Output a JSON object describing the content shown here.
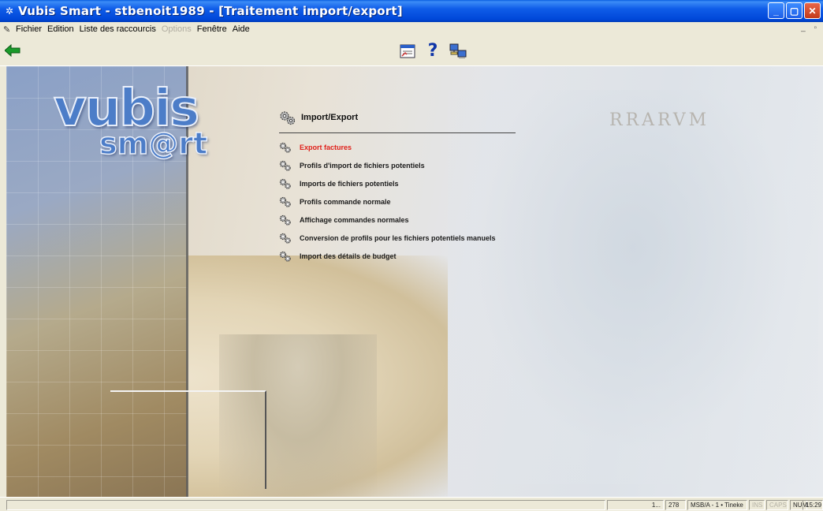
{
  "window": {
    "title": "Vubis Smart - stbenoit1989 - [Traitement import/export]",
    "controls": {
      "minimize": "_",
      "maximize": "▢",
      "close": "✕"
    }
  },
  "menubar": {
    "items": [
      {
        "label": "Fichier",
        "enabled": true
      },
      {
        "label": "Edition",
        "enabled": true
      },
      {
        "label": "Liste des raccourcis",
        "enabled": true
      },
      {
        "label": "Options",
        "enabled": false
      },
      {
        "label": "Fenêtre",
        "enabled": true
      },
      {
        "label": "Aide",
        "enabled": true
      }
    ],
    "mdi_controls": "_ ▫"
  },
  "toolbar": {
    "help_symbol": "?"
  },
  "background": {
    "logo_line1": "vubis",
    "logo_line2": "sm@rt",
    "inscription": "RRARVM"
  },
  "panel": {
    "title": "Import/Export",
    "options": [
      {
        "label": "Export factures",
        "active": true
      },
      {
        "label": "Profils d'import de fichiers potentiels",
        "active": false
      },
      {
        "label": "Imports de fichiers potentiels",
        "active": false
      },
      {
        "label": "Profils commande normale",
        "active": false
      },
      {
        "label": "Affichage commandes normales",
        "active": false
      },
      {
        "label": "Conversion de profils pour les fichiers potentiels manuels",
        "active": false
      },
      {
        "label": "Import des détails de budget",
        "active": false
      }
    ]
  },
  "statusbar": {
    "record": "1...",
    "count": "278",
    "session": "MSB/A - 1 • Tineke",
    "ins": "INS",
    "caps": "CAPS",
    "num": "NUM",
    "time": "15:29"
  },
  "colors": {
    "titlebar": "#0047d8",
    "active_option": "#e0201a",
    "logo": "#4c7dc8",
    "back_arrow": "#1a9a2a"
  }
}
